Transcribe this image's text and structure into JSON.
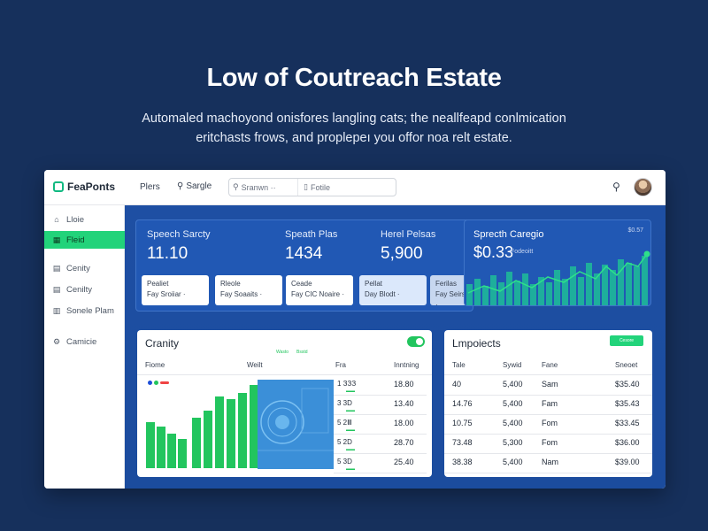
{
  "hero": {
    "title": "Low of Coutreach Estate",
    "subtitle_line1": "Automaled machoyond onisfores langling cats; the neallfeapd conlmication",
    "subtitle_line2": "eritchasts frows, and proplepeı you offor noa relt estate."
  },
  "topbar": {
    "brand": "FeaPonts",
    "nav_plans": "Plers",
    "nav_search": "Sargle",
    "search_seg1": "Sranwn ··",
    "search_seg2": "Fotile",
    "icons": [
      "search-icon",
      "avatar"
    ]
  },
  "sidebar": {
    "items": [
      {
        "label": "Lloie",
        "icon": "home-icon"
      },
      {
        "label": "Fleid",
        "icon": "grid-icon",
        "active": true
      },
      {
        "label": "Cenity",
        "icon": "document-icon"
      },
      {
        "label": "Cenilty",
        "icon": "document-icon"
      },
      {
        "label": "Sonele Plam",
        "icon": "table-icon"
      },
      {
        "label": "Camicie",
        "icon": "gear-icon"
      }
    ]
  },
  "stats": {
    "items": [
      {
        "label": "Speech Sarcty",
        "value": "11.10"
      },
      {
        "label": "Speath Plas",
        "value": "1434"
      },
      {
        "label": "Herel Pelsas",
        "value": "5,900"
      }
    ],
    "cards": [
      {
        "title": "Pealiet",
        "sub": "Fay Sroiiar ·"
      },
      {
        "title": "Rleole",
        "sub": "Fay Soaaits ·"
      },
      {
        "title": "Ceade",
        "sub": "Fay CIC Noaire ·"
      },
      {
        "title": "Pellat",
        "sub": "Day Blodt ·"
      },
      {
        "title": "Ferilas",
        "sub": "Fay Seirs ·"
      }
    ]
  },
  "trend": {
    "title": "Sprecth Caregio",
    "value": "$0.33",
    "sub": "Fodeoitt",
    "corner": "$0.57",
    "accent": "#22c55e"
  },
  "activity": {
    "title": "Cranity",
    "legend": [
      "Wasto",
      "Bsstd"
    ],
    "columns": [
      "Fiome",
      "Weilt",
      "Fra",
      "Inntning"
    ],
    "rows": [
      {
        "a": "1 ЗЗЗ",
        "b": "18.80"
      },
      {
        "a": "3 3D",
        "b": "13.40"
      },
      {
        "a": "5 2Ⅲ",
        "b": "18.00"
      },
      {
        "a": "5 2D",
        "b": "28.70"
      },
      {
        "a": "5 3D",
        "b": "25.40"
      }
    ],
    "bars": [
      0.4,
      0.36,
      0.3,
      0.25,
      0.44,
      0.5,
      0.62,
      0.6,
      0.65,
      0.72
    ],
    "colors": {
      "bar": "#22c55e",
      "dot_blue": "#1d4ed8",
      "dot_red": "#ef4444"
    }
  },
  "employees": {
    "title": "Lmpoiects",
    "button": "Cesore",
    "columns": [
      "Tale",
      "Sywid",
      "Fane",
      "Sneoet"
    ],
    "rows": [
      [
        "40",
        "5,400",
        "Sam",
        "$35.40"
      ],
      [
        "14.76",
        "5,400",
        "Fam",
        "$35.43"
      ],
      [
        "10.75",
        "5,400",
        "Fom",
        "$33.45"
      ],
      [
        "73.48",
        "5,300",
        "Fom",
        "$36.00"
      ],
      [
        "38.38",
        "5,400",
        "Nam",
        "$39.00"
      ]
    ]
  }
}
